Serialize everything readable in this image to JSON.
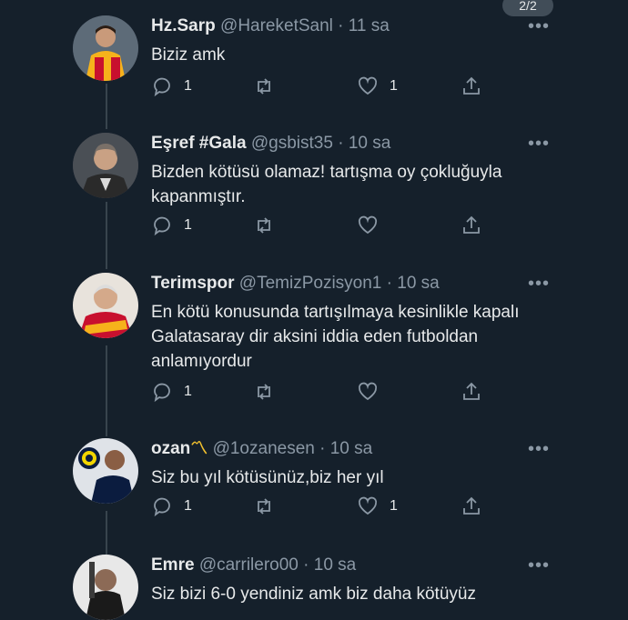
{
  "page_indicator": "2/2",
  "tweets": [
    {
      "display_name": "Hz.Sarp",
      "handle": "@HareketSanl",
      "time": "11 sa",
      "text": "Biziz amk",
      "reply_count": "1",
      "retweet_count": "",
      "like_count": "1",
      "avatar_colors": [
        "#c8102e",
        "#f6b21b"
      ]
    },
    {
      "display_name": "Eşref #Gala",
      "handle": "@gsbist35",
      "time": "10 sa",
      "text": "Bizden kötüsü olamaz! tartışma oy çokluğuyla kapanmıştır.",
      "reply_count": "1",
      "retweet_count": "",
      "like_count": "",
      "avatar_colors": [
        "#2a2a2a",
        "#d9d9d9"
      ]
    },
    {
      "display_name": "Terimspor",
      "handle": "@TemizPozisyon1",
      "time": "10 sa",
      "text": "En kötü konusunda tartışılmaya kesinlikle kapalı Galatasaray dir aksini iddia eden futboldan anlamıyordur",
      "reply_count": "1",
      "retweet_count": "",
      "like_count": "",
      "avatar_colors": [
        "#c8102e",
        "#f6b21b"
      ]
    },
    {
      "display_name": "ozan",
      "badge": "〽",
      "handle": "@1ozanesen",
      "time": "10 sa",
      "text": "Siz bu yıl kötüsünüz,biz her yıl",
      "reply_count": "1",
      "retweet_count": "",
      "like_count": "1",
      "avatar_colors": [
        "#0b1c3f",
        "#f2d500"
      ]
    },
    {
      "display_name": "Emre",
      "handle": "@carrilero00",
      "time": "10 sa",
      "text": "Siz bizi 6-0 yendiniz amk biz daha kötüyüz",
      "reply_count": "",
      "retweet_count": "",
      "like_count": "",
      "avatar_colors": [
        "#e8e8e8",
        "#1a1a1a"
      ]
    }
  ],
  "icons": {
    "reply": "reply-icon",
    "retweet": "retweet-icon",
    "like": "like-icon",
    "share": "share-icon",
    "more": "more-icon"
  },
  "colors": {
    "background": "#15202b",
    "text": "#e7e9ea",
    "muted": "#8b98a5",
    "thread_line": "#38444d"
  }
}
